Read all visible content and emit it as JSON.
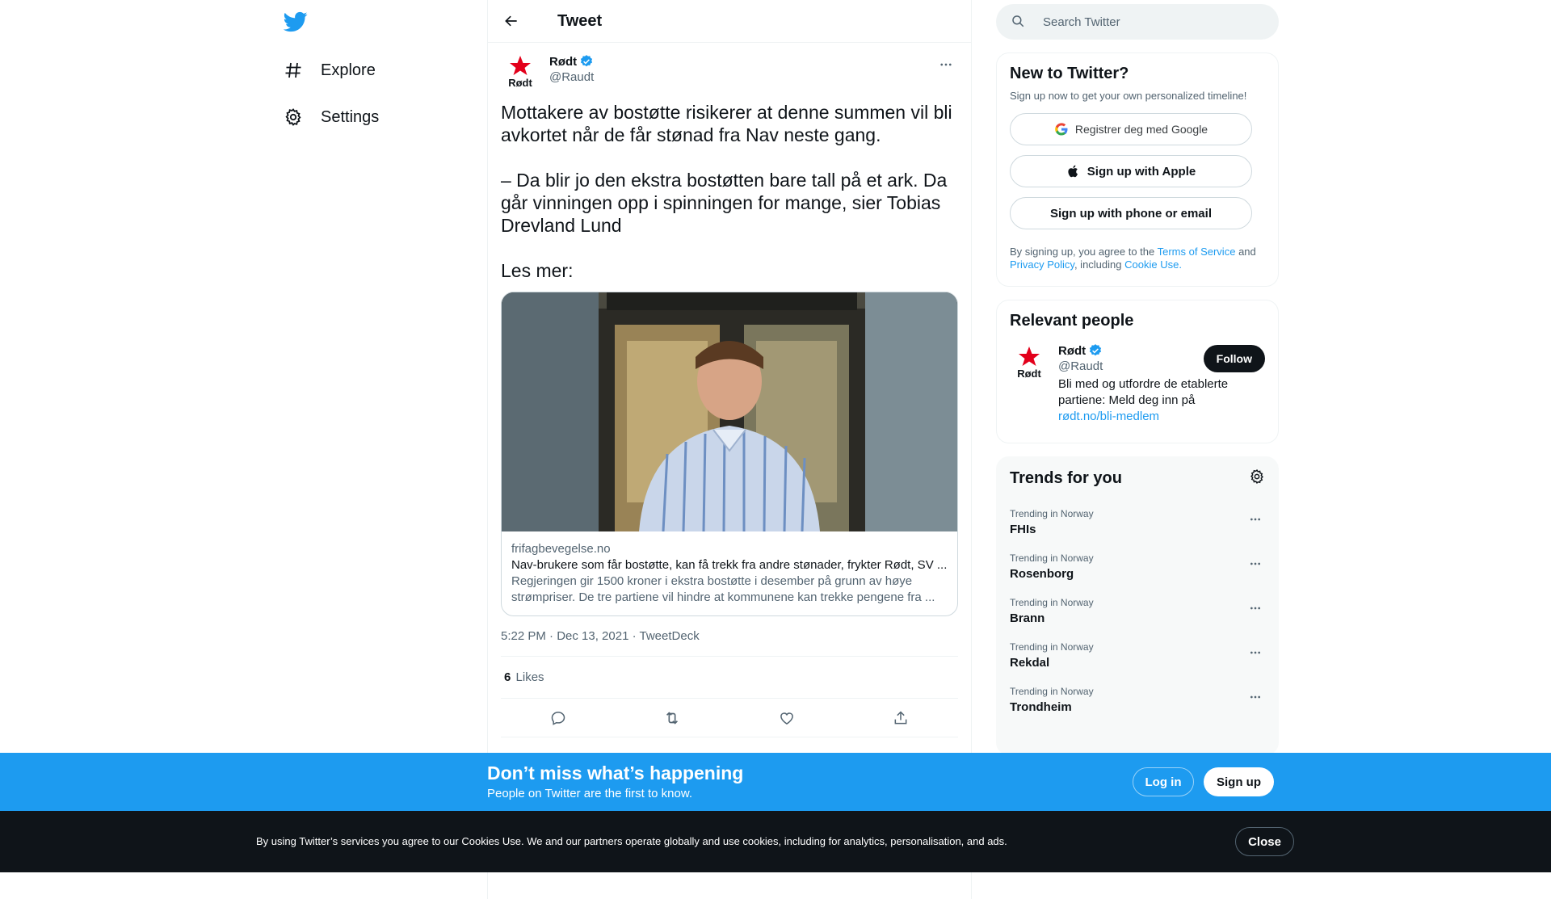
{
  "nav": {
    "explore_label": "Explore",
    "settings_label": "Settings"
  },
  "header": {
    "title": "Tweet"
  },
  "tweet": {
    "author_name": "Rødt",
    "author_handle": "@Raudt",
    "avatar_text": "Rødt",
    "paragraphs": [
      "Mottakere av bostøtte risikerer at denne summen vil bli avkortet når de får stønad fra Nav neste gang.",
      "– Da blir jo den ekstra bostøtten bare tall på et ark. Da går vinningen opp i spinningen for mange, sier Tobias Drevland Lund",
      "Les mer:"
    ],
    "card": {
      "domain": "frifagbevegelse.no",
      "title": "Nav-brukere som får bostøtte, kan få trekk fra andre stønader, frykter Rødt, SV ...",
      "description": "Regjeringen gir 1500 kroner i ekstra bostøtte i desember på grunn av høye strømpriser. De tre partiene vil hindre at kommunene kan trekke pengene fra ..."
    },
    "time": "5:22 PM · Dec 13, 2021",
    "source": "TweetDeck",
    "likes_count": "6",
    "likes_label": "Likes"
  },
  "search": {
    "placeholder": "Search Twitter"
  },
  "new_to_twitter": {
    "title": "New to Twitter?",
    "subtitle": "Sign up now to get your own personalized timeline!",
    "google_label": "Registrer deg med Google",
    "apple_label": "Sign up with Apple",
    "phone_label": "Sign up with phone or email",
    "terms_prefix": "By signing up, you agree to the",
    "terms_link": "Terms of Service",
    "terms_and": "and",
    "privacy_link": "Privacy Policy",
    "including": ", including",
    "cookie_link": "Cookie Use."
  },
  "relevant_people": {
    "title": "Relevant people",
    "name": "Rødt",
    "handle": "@Raudt",
    "bio": "Bli med og utfordre de etablerte partiene: Meld deg inn på",
    "bio_link": "rødt.no/bli-medlem",
    "follow_label": "Follow"
  },
  "trends": {
    "title": "Trends for you",
    "items": [
      {
        "meta": "Trending in Norway",
        "name": "FHIs"
      },
      {
        "meta": "Trending in Norway",
        "name": "Rosenborg"
      },
      {
        "meta": "Trending in Norway",
        "name": "Brann"
      },
      {
        "meta": "Trending in Norway",
        "name": "Rekdal"
      },
      {
        "meta": "Trending in Norway",
        "name": "Trondheim"
      }
    ]
  },
  "promo": {
    "title": "Don’t miss what’s happening",
    "subtitle": "People on Twitter are the first to know.",
    "login_label": "Log in",
    "signup_label": "Sign up"
  },
  "cookie": {
    "text": "By using Twitter’s services you agree to our Cookies Use. We and our partners operate globally and use cookies, including for analytics, personalisation, and ads.",
    "close_label": "Close"
  },
  "colors": {
    "accent": "#1d9bf0",
    "text": "#0f1419",
    "muted": "#536471",
    "rodt_red": "#e3001b"
  }
}
